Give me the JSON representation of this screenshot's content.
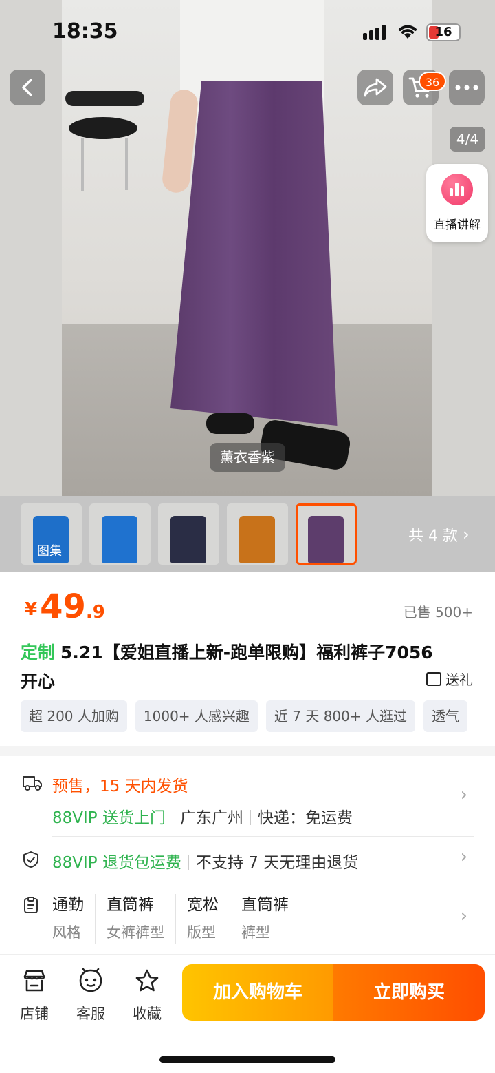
{
  "status_bar": {
    "time": "18:35",
    "battery": "16"
  },
  "nav": {
    "cart_count": "36",
    "image_counter": "4/4"
  },
  "live": {
    "label": "直播讲解"
  },
  "hero": {
    "color_label": "薰衣香紫"
  },
  "thumbnails": {
    "items": [
      {
        "tag": "图集",
        "color": "#1e6fc9"
      },
      {
        "tag": "",
        "color": "#1f72cf"
      },
      {
        "tag": "",
        "color": "#2a2d45"
      },
      {
        "tag": "",
        "color": "#c8721a"
      },
      {
        "tag": "",
        "color": "#5d3d6c"
      }
    ],
    "total": "共 4 款"
  },
  "product": {
    "currency": "¥",
    "price_int": "49",
    "price_dec": ".9",
    "sold": "已售 500+",
    "custom_label": "定制",
    "title": "5.21【爱姐直播上新-跑单限购】福利裤子7056 开心",
    "gift": "送礼",
    "tags": [
      "超 200 人加购",
      "1000+ 人感兴趣",
      "近 7 天 800+ 人逛过",
      "透气"
    ]
  },
  "shipping": {
    "presale": "预售，15 天内发货",
    "vip_delivery": "88VIP 送货上门",
    "origin": "广东广州",
    "express": "快递：免运费"
  },
  "returns": {
    "vip_return": "88VIP 退货包运费",
    "policy": "不支持 7 天无理由退货"
  },
  "attributes": [
    {
      "value": "通勤",
      "key": "风格"
    },
    {
      "value": "直筒裤",
      "key": "女裤裤型"
    },
    {
      "value": "宽松",
      "key": "版型"
    },
    {
      "value": "直筒裤",
      "key": "裤型"
    }
  ],
  "bottom_bar": {
    "shop": "店铺",
    "service": "客服",
    "favorite": "收藏",
    "add_to_cart": "加入购物车",
    "buy_now": "立即购买"
  },
  "colors": {
    "accent": "#ff5000",
    "green": "#2fb34f"
  }
}
